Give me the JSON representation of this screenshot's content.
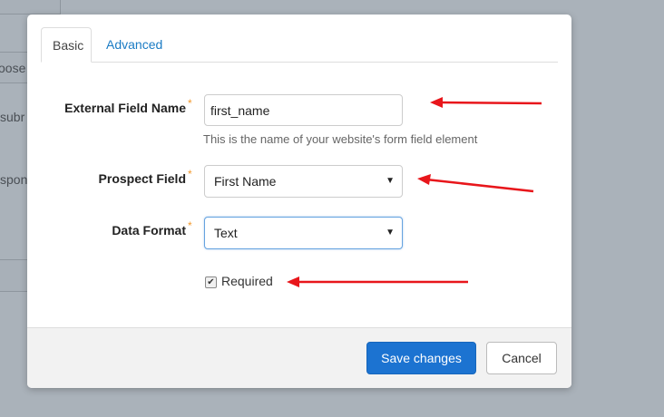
{
  "background": {
    "fragments": [
      "oose",
      "subr",
      "spon"
    ]
  },
  "modal": {
    "tabs": [
      {
        "label": "Basic",
        "active": true
      },
      {
        "label": "Advanced",
        "active": false
      }
    ],
    "fields": {
      "external_field_name": {
        "label": "External Field Name",
        "value": "first_name",
        "help": "This is the name of your website's form field element"
      },
      "prospect_field": {
        "label": "Prospect Field",
        "selected": "First Name"
      },
      "data_format": {
        "label": "Data Format",
        "selected": "Text"
      },
      "required": {
        "label": "Required",
        "checked": true
      },
      "required_marker": "*"
    },
    "footer": {
      "save_label": "Save changes",
      "cancel_label": "Cancel"
    }
  },
  "colors": {
    "primary": "#1c73d1",
    "link": "#1a7bc4",
    "required_marker": "#f29a2e",
    "arrow": "#e8161b"
  }
}
